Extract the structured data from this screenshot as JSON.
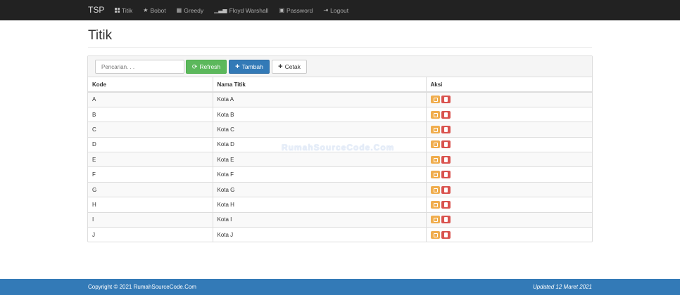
{
  "navbar": {
    "brand": "TSP",
    "items": [
      {
        "label": "Titik",
        "icon": "th-large-icon"
      },
      {
        "label": "Bobot",
        "icon": "star-icon"
      },
      {
        "label": "Greedy",
        "icon": "calendar-icon"
      },
      {
        "label": "Floyd Warshall",
        "icon": "signal-icon"
      },
      {
        "label": "Password",
        "icon": "lock-icon"
      },
      {
        "label": "Logout",
        "icon": "logout-icon"
      }
    ]
  },
  "page": {
    "title": "Titik"
  },
  "toolbar": {
    "search_placeholder": "Pencarian. . .",
    "refresh_label": "Refresh",
    "tambah_label": "Tambah",
    "cetak_label": "Cetak"
  },
  "table": {
    "headers": [
      "Kode",
      "Nama Titik",
      "Aksi"
    ],
    "rows": [
      {
        "kode": "A",
        "nama": "Kota A"
      },
      {
        "kode": "B",
        "nama": "Kota B"
      },
      {
        "kode": "C",
        "nama": "Kota C"
      },
      {
        "kode": "D",
        "nama": "Kota D"
      },
      {
        "kode": "E",
        "nama": "Kota E"
      },
      {
        "kode": "F",
        "nama": "Kota F"
      },
      {
        "kode": "G",
        "nama": "Kota G"
      },
      {
        "kode": "H",
        "nama": "Kota H"
      },
      {
        "kode": "I",
        "nama": "Kota I"
      },
      {
        "kode": "J",
        "nama": "Kota J"
      }
    ]
  },
  "watermark": "RumahSourceCode.Com",
  "footer": {
    "copyright": "Copyright © 2021 RumahSourceCode.Com",
    "updated": "Updated 12 Maret 2021"
  },
  "colors": {
    "navbar": "#222222",
    "refresh": "#5cb85c",
    "primary": "#337ab7",
    "edit": "#f0ad4e",
    "delete": "#d9534f"
  }
}
